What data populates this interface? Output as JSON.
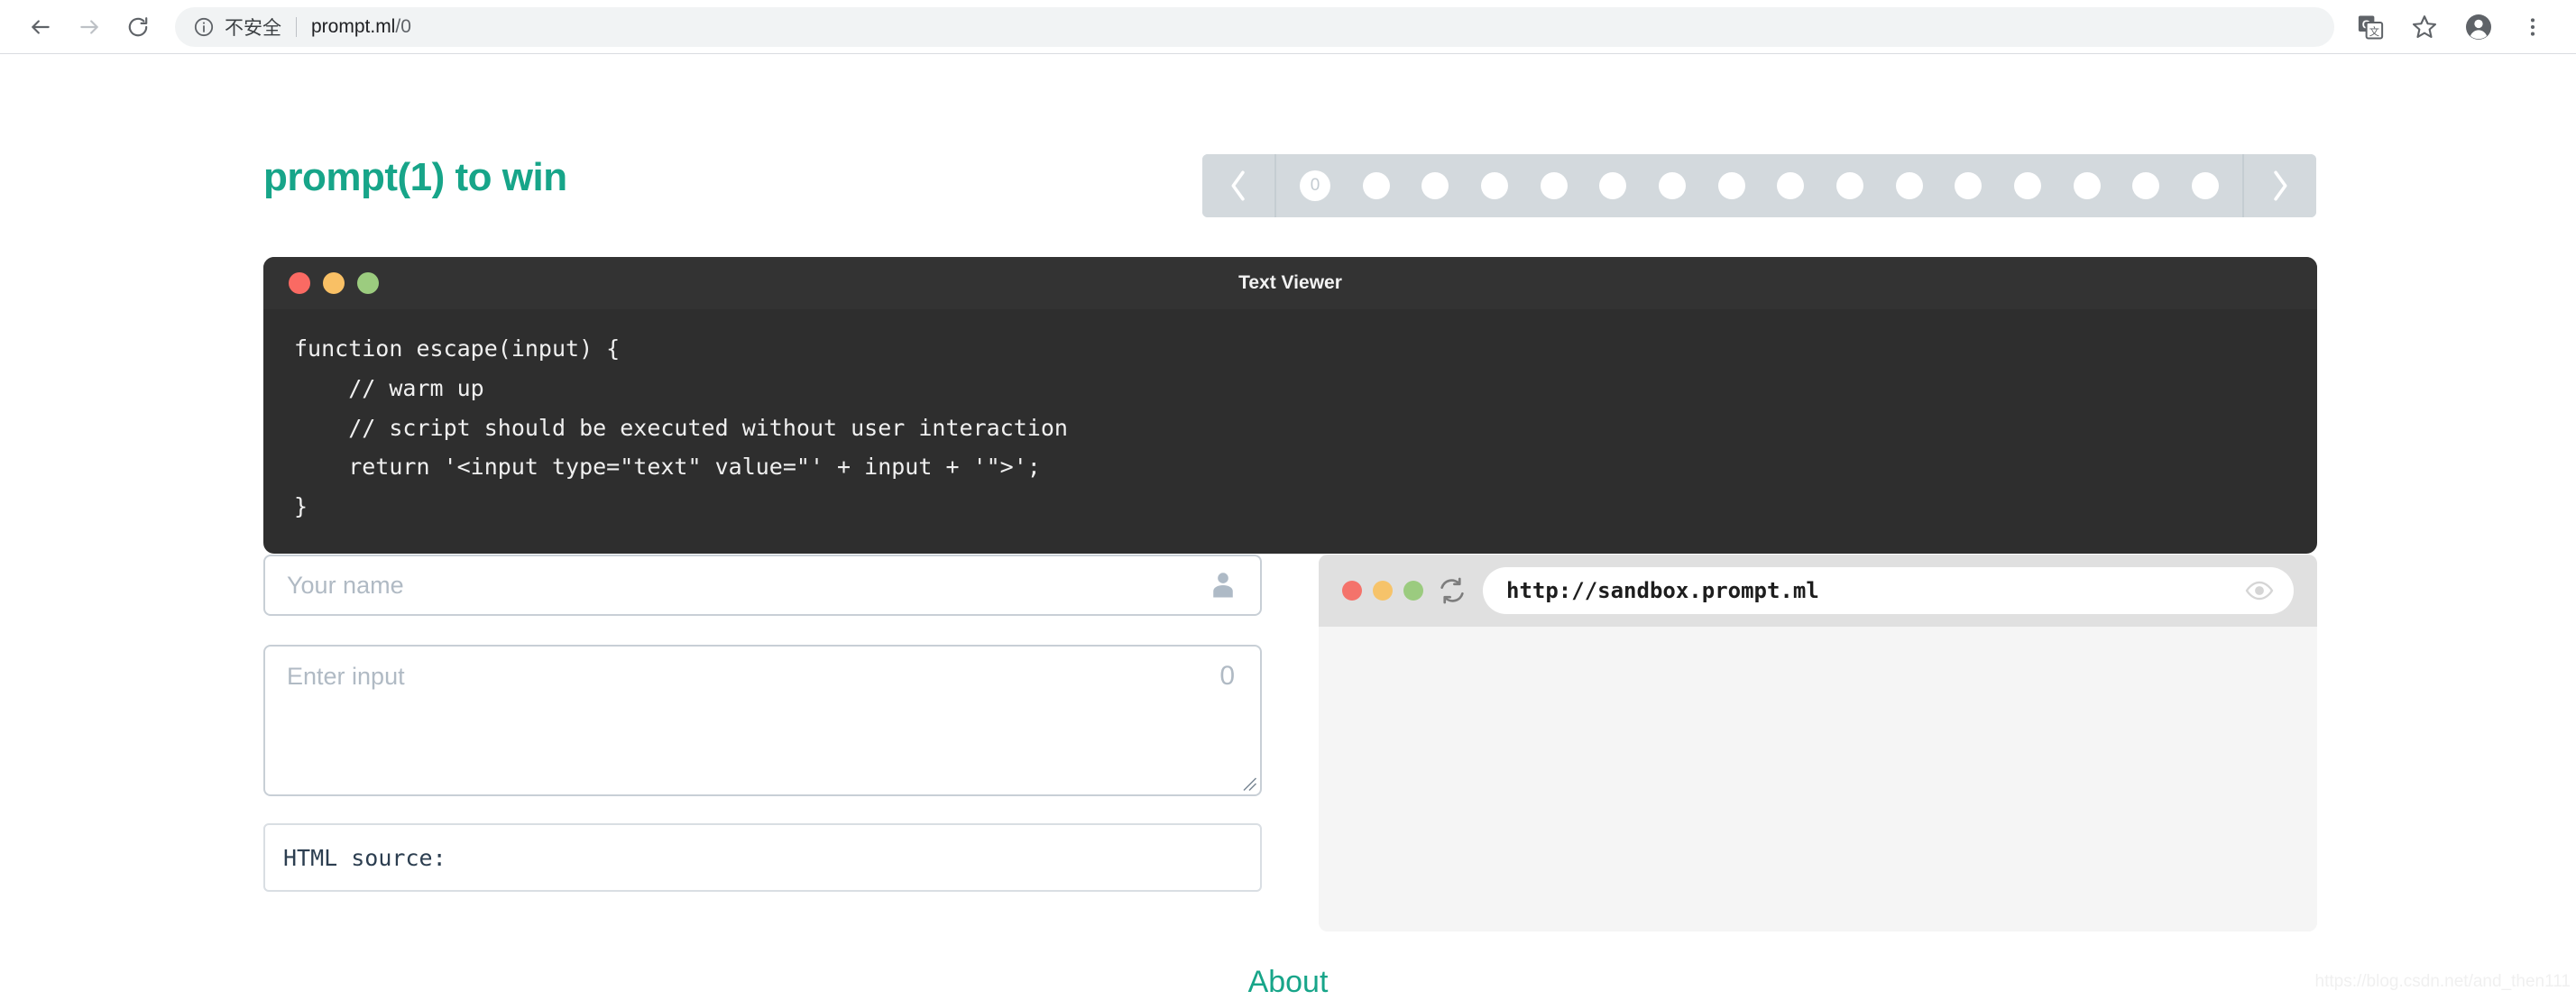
{
  "browser": {
    "back_label": "Back",
    "forward_label": "Forward",
    "reload_label": "Reload",
    "security_text": "不安全",
    "url_main": "prompt.ml",
    "url_path": "/0",
    "translate_label": "Translate this page",
    "bookmark_label": "Bookmark this tab",
    "profile_label": "Profile",
    "menu_label": "Customize and control Google Chrome"
  },
  "header": {
    "site_title": "prompt(1) to win"
  },
  "pager": {
    "prev_label": "‹",
    "next_label": "›",
    "active_index": 0,
    "levels": [
      "0",
      "",
      "",
      "",
      "",
      "",
      "",
      "",
      "",
      "",
      "",
      "",
      "",
      "",
      "",
      ""
    ]
  },
  "viewer": {
    "title": "Text Viewer",
    "code": "function escape(input) {\n    // warm up\n    // script should be executed without user interaction\n    return '<input type=\"text\" value=\"' + input + '\">';\n}"
  },
  "form": {
    "name_placeholder": "Your name",
    "name_value": "",
    "input_placeholder": "Enter input",
    "input_value": "",
    "char_count": "0",
    "source_label": "HTML source:"
  },
  "sandbox": {
    "url": "http://sandbox.prompt.ml",
    "content": ""
  },
  "footer": {
    "about_label": "About",
    "watermark": "https://blog.csdn.net/and_then111"
  },
  "colors": {
    "accent": "#17a589",
    "viewer_bg": "#2e2e2e",
    "viewer_header": "#333333",
    "pager_bg": "#d3d9dd",
    "sandbox_header": "#e0e0e0",
    "sandbox_body": "#f5f5f5",
    "field_border": "#c8cfd6",
    "placeholder": "#b0bac4"
  }
}
